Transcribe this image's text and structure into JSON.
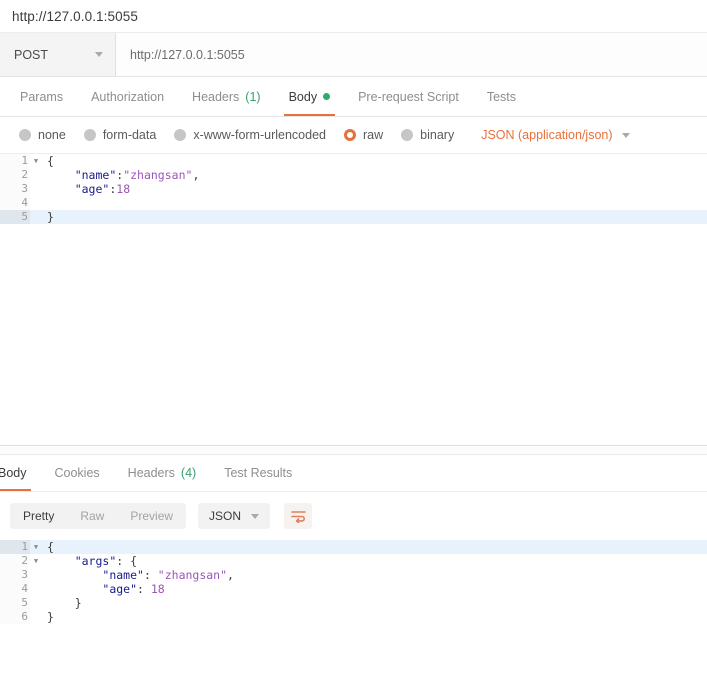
{
  "request": {
    "title": "http://127.0.0.1:5055",
    "method": "POST",
    "url": "http://127.0.0.1:5055",
    "method_caret_icon": "chevron-down-icon",
    "tabs": [
      {
        "label": "Params",
        "active": false,
        "count": "",
        "dot": false
      },
      {
        "label": "Authorization",
        "active": false,
        "count": "",
        "dot": false
      },
      {
        "label": "Headers",
        "active": false,
        "count": "(1)",
        "dot": false
      },
      {
        "label": "Body",
        "active": true,
        "count": "",
        "dot": true
      },
      {
        "label": "Pre-request Script",
        "active": false,
        "count": "",
        "dot": false
      },
      {
        "label": "Tests",
        "active": false,
        "count": "",
        "dot": false
      }
    ],
    "body_types": [
      {
        "label": "none",
        "selected": false
      },
      {
        "label": "form-data",
        "selected": false
      },
      {
        "label": "x-www-form-urlencoded",
        "selected": false
      },
      {
        "label": "raw",
        "selected": true
      },
      {
        "label": "binary",
        "selected": false
      }
    ],
    "content_type": "JSON (application/json)",
    "content_type_caret_icon": "chevron-down-icon",
    "body_lines": [
      {
        "n": "1",
        "fold": "▼",
        "active": false,
        "tokens": [
          {
            "t": "{",
            "c": "tk-pun"
          }
        ]
      },
      {
        "n": "2",
        "fold": "",
        "active": false,
        "tokens": [
          {
            "t": "    ",
            "c": "tk-pun"
          },
          {
            "t": "\"name\"",
            "c": "tk-key"
          },
          {
            "t": ":",
            "c": "tk-pun"
          },
          {
            "t": "\"zhangsan\"",
            "c": "tk-str"
          },
          {
            "t": ",",
            "c": "tk-pun"
          }
        ]
      },
      {
        "n": "3",
        "fold": "",
        "active": false,
        "tokens": [
          {
            "t": "    ",
            "c": "tk-pun"
          },
          {
            "t": "\"age\"",
            "c": "tk-key"
          },
          {
            "t": ":",
            "c": "tk-pun"
          },
          {
            "t": "18",
            "c": "tk-num"
          }
        ]
      },
      {
        "n": "4",
        "fold": "",
        "active": false,
        "tokens": []
      },
      {
        "n": "5",
        "fold": "",
        "active": true,
        "tokens": [
          {
            "t": "}",
            "c": "tk-pun"
          }
        ]
      }
    ]
  },
  "response": {
    "tabs": [
      {
        "label": "Body",
        "active": true,
        "count": ""
      },
      {
        "label": "Cookies",
        "active": false,
        "count": ""
      },
      {
        "label": "Headers",
        "active": false,
        "count": "(4)"
      },
      {
        "label": "Test Results",
        "active": false,
        "count": ""
      }
    ],
    "view_modes": [
      {
        "label": "Pretty",
        "active": true
      },
      {
        "label": "Raw",
        "active": false
      },
      {
        "label": "Preview",
        "active": false
      }
    ],
    "format": "JSON",
    "format_caret_icon": "chevron-down-icon",
    "wrap_icon": "word-wrap-icon",
    "body_lines": [
      {
        "n": "1",
        "fold": "▼",
        "active": true,
        "tokens": [
          {
            "t": "{",
            "c": "tk-pun"
          }
        ]
      },
      {
        "n": "2",
        "fold": "▼",
        "active": false,
        "tokens": [
          {
            "t": "    ",
            "c": "tk-pun"
          },
          {
            "t": "\"args\"",
            "c": "tk-key"
          },
          {
            "t": ": {",
            "c": "tk-pun"
          }
        ]
      },
      {
        "n": "3",
        "fold": "",
        "active": false,
        "tokens": [
          {
            "t": "        ",
            "c": "tk-pun"
          },
          {
            "t": "\"name\"",
            "c": "tk-key"
          },
          {
            "t": ": ",
            "c": "tk-pun"
          },
          {
            "t": "\"zhangsan\"",
            "c": "tk-str"
          },
          {
            "t": ",",
            "c": "tk-pun"
          }
        ]
      },
      {
        "n": "4",
        "fold": "",
        "active": false,
        "tokens": [
          {
            "t": "        ",
            "c": "tk-pun"
          },
          {
            "t": "\"age\"",
            "c": "tk-key"
          },
          {
            "t": ": ",
            "c": "tk-pun"
          },
          {
            "t": "18",
            "c": "tk-num"
          }
        ]
      },
      {
        "n": "5",
        "fold": "",
        "active": false,
        "tokens": [
          {
            "t": "    }",
            "c": "tk-pun"
          }
        ]
      },
      {
        "n": "6",
        "fold": "",
        "active": false,
        "tokens": [
          {
            "t": "}",
            "c": "tk-pun"
          }
        ]
      }
    ]
  },
  "colors": {
    "accent_orange": "#e8703a",
    "status_green": "#2fab6c",
    "json_key": "#1a1a8c",
    "json_string": "#9a57b8",
    "active_line": "#e8f2fc"
  }
}
